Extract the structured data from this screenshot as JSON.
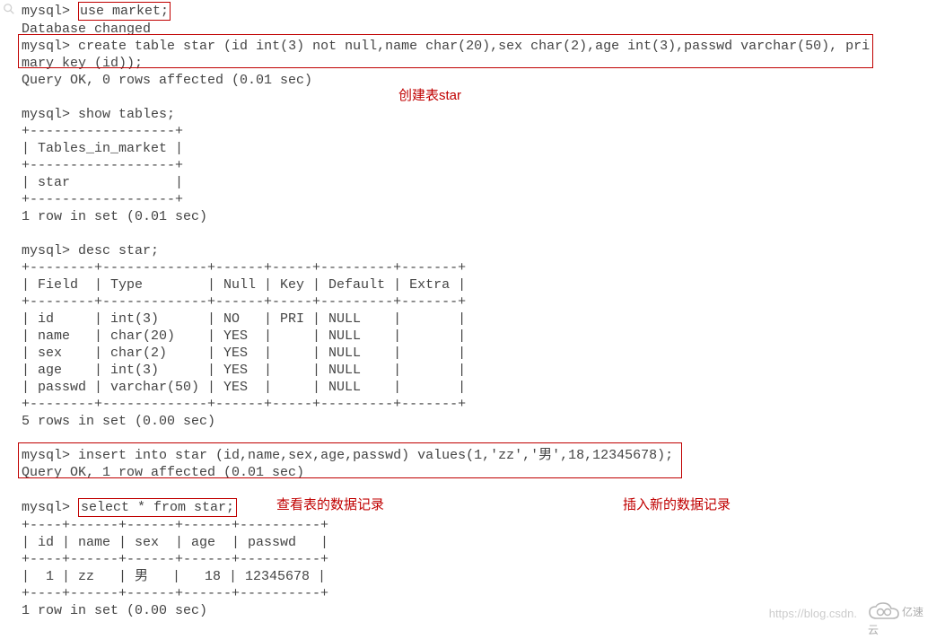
{
  "magnify_icon": "magnify",
  "terminal": {
    "prompt": "mysql>",
    "use_cmd": "use market;",
    "db_changed": "Database changed",
    "create_cmd": "create table star (id int(3) not null,name char(20),sex char(2),age int(3),passwd varchar(50), primary key (id));",
    "create_ok": "Query OK, 0 rows affected (0.01 sec)",
    "show_tables_cmd": "show tables;",
    "tables_border": "+------------------+",
    "tables_header": "| Tables_in_market |",
    "tables_row": "| star             |",
    "tables_footer": "1 row in set (0.01 sec)",
    "desc_cmd": "desc star;",
    "desc_border": "+--------+-------------+------+-----+---------+-------+",
    "desc_header": "| Field  | Type        | Null | Key | Default | Extra |",
    "desc_rows": [
      "| id     | int(3)      | NO   | PRI | NULL    |       |",
      "| name   | char(20)    | YES  |     | NULL    |       |",
      "| sex    | char(2)     | YES  |     | NULL    |       |",
      "| age    | int(3)      | YES  |     | NULL    |       |",
      "| passwd | varchar(50) | YES  |     | NULL    |       |"
    ],
    "desc_footer": "5 rows in set (0.00 sec)",
    "insert_cmd": "insert into star (id,name,sex,age,passwd) values(1,'zz','男',18,12345678);",
    "insert_ok": "Query OK, 1 row affected (0.01 sec)",
    "select_cmd": "select * from star;",
    "select_border": "+----+------+------+------+----------+",
    "select_header": "| id | name | sex  | age  | passwd   |",
    "select_row": "|  1 | zz   | 男   |   18 | 12345678 |",
    "select_footer": "1 row in set (0.00 sec)"
  },
  "annotations": {
    "create_label": "创建表star",
    "select_label": "查看表的数据记录",
    "insert_label": "插入新的数据记录"
  },
  "watermark": "https://blog.csdn.",
  "logo_text": "亿速云",
  "chart_data": {
    "type": "table",
    "desc_table": {
      "columns": [
        "Field",
        "Type",
        "Null",
        "Key",
        "Default",
        "Extra"
      ],
      "rows": [
        [
          "id",
          "int(3)",
          "NO",
          "PRI",
          "NULL",
          ""
        ],
        [
          "name",
          "char(20)",
          "YES",
          "",
          "NULL",
          ""
        ],
        [
          "sex",
          "char(2)",
          "YES",
          "",
          "NULL",
          ""
        ],
        [
          "age",
          "int(3)",
          "YES",
          "",
          "NULL",
          ""
        ],
        [
          "passwd",
          "varchar(50)",
          "YES",
          "",
          "NULL",
          ""
        ]
      ]
    },
    "select_table": {
      "columns": [
        "id",
        "name",
        "sex",
        "age",
        "passwd"
      ],
      "rows": [
        [
          1,
          "zz",
          "男",
          18,
          "12345678"
        ]
      ]
    }
  }
}
